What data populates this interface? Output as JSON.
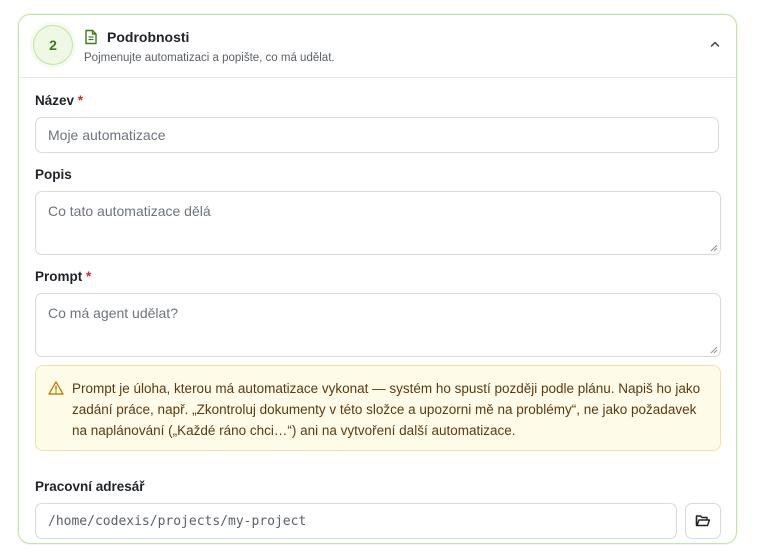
{
  "section": {
    "step_number": "2",
    "title": "Podrobnosti",
    "subtitle": "Pojmenujte automatizaci a popište, co má udělat.",
    "accent_color": "#7cc04a"
  },
  "fields": {
    "name": {
      "label": "Název",
      "required_mark": "*",
      "placeholder": "Moje automatizace",
      "value": ""
    },
    "description": {
      "label": "Popis",
      "placeholder": "Co tato automatizace dělá",
      "value": ""
    },
    "prompt": {
      "label": "Prompt",
      "required_mark": "*",
      "placeholder": "Co má agent udělat?",
      "value": ""
    },
    "workdir": {
      "label": "Pracovní adresář",
      "value": "/home/codexis/projects/my-project"
    }
  },
  "warning": {
    "icon": "warning-triangle-icon",
    "text": "Prompt je úloha, kterou má automatizace vykonat — systém ho spustí později podle plánu. Napiš ho jako zadání práce, např. „Zkontroluj dokumenty v této složce a upozorni mě na problémy“, ne jako požadavek na naplánování („Každé ráno chci…“) ani na vytvoření další automatizace."
  },
  "icons": {
    "header": "document-icon",
    "collapse": "chevron-up-icon",
    "browse": "folder-open-icon"
  }
}
